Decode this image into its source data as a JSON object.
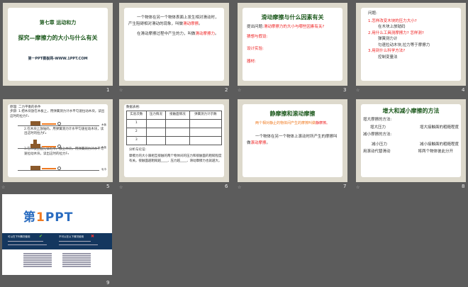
{
  "slides": [
    {
      "num": "1",
      "chapter": "第七章  运动和力",
      "title": "探究—摩擦力的大小与什么有关",
      "footer": "第一PPT模板网-WWW.1PPT.COM"
    },
    {
      "num": "2",
      "p1a": "一个物体在另一个物体表面上发生相对滑动时，产生阻碍相对滑动的现象，叫做",
      "p1b": "滑动摩擦",
      "p1c": "。",
      "p2a": "在滑动摩擦过程中产生的力，叫做",
      "p2b": "滑动摩擦力",
      "p2c": "。"
    },
    {
      "num": "3",
      "title": "滑动摩擦与什么因素有关",
      "q_label": "提出问题:",
      "q": "滑动摩擦力的大小与哪些因素有关?",
      "guess": "猜想与假设:",
      "design": "设计实验:",
      "tools": "器材:"
    },
    {
      "num": "4",
      "heading": "问题:",
      "q1": "1.怎样改变木块的压力大小?",
      "a1": "在木块上放砝码",
      "q2": "2.用什么工具测摩擦力? 怎样测?",
      "a2a": "弹簧测力计",
      "a2b": "匀速拉动木块,拉力等于摩擦力",
      "q3": "3.用到什么科学方法?",
      "a3": "控制变量法"
    },
    {
      "num": "5",
      "principle": "原理: 二力平衡的条件",
      "step1": "步骤: 1.把木块放在木板上，用弹簧测力计水平匀速拉动木块，读出这时的拉力F₁",
      "step2": "2.在木块上放砝码，用弹簧测力计水平匀速拉动木块，读出这时的拉力F₂",
      "step3": "3.在木板上面先铺毛巾，放上木块，用弹簧测力计水平匀速拉动木块，读出这时的拉力F₃",
      "lab1": "木板",
      "lab2": "木板",
      "lab3": "毛巾"
    },
    {
      "num": "6",
      "heading": "数据表格:",
      "cols": [
        "实验次数",
        "压力情况",
        "接触面情况",
        "弹簧测力计示数"
      ],
      "rows": [
        "1",
        "2",
        "3"
      ],
      "analysis": "分析与论证:",
      "conclusion": "摩擦力的大小跟相互接触的两个物体间的压力和接触面的粗糙程度有关。接触面越粗糙越____，压力越____，滑动摩擦力也就越大。"
    },
    {
      "num": "7",
      "title": "静摩擦和滚动摩擦",
      "p1a": "两个相对静止的物体间产生的摩擦叫做",
      "p1b": "静摩擦",
      "p1c": "。",
      "p2a": "一个物体在另一个物体上滚动时所产生的摩擦叫做",
      "p2b": "滚动摩擦",
      "p2c": "。"
    },
    {
      "num": "8",
      "title": "增大和减小摩擦的方法",
      "inc": "增大摩擦的方法:",
      "inc1": "增大压力",
      "inc2": "增大接触面的粗糙程度",
      "dec": "减小摩擦的方法:",
      "dec1": "减小压力",
      "dec2": "减小接触面的粗糙程度",
      "dec3": "用滚动代替滑动",
      "dec4": "将两个物体彼此分开"
    },
    {
      "num": "9",
      "logo": "第1PPT",
      "left_head": "可以在下列情况使用",
      "right_head": "不可以在以下情况使用"
    }
  ]
}
